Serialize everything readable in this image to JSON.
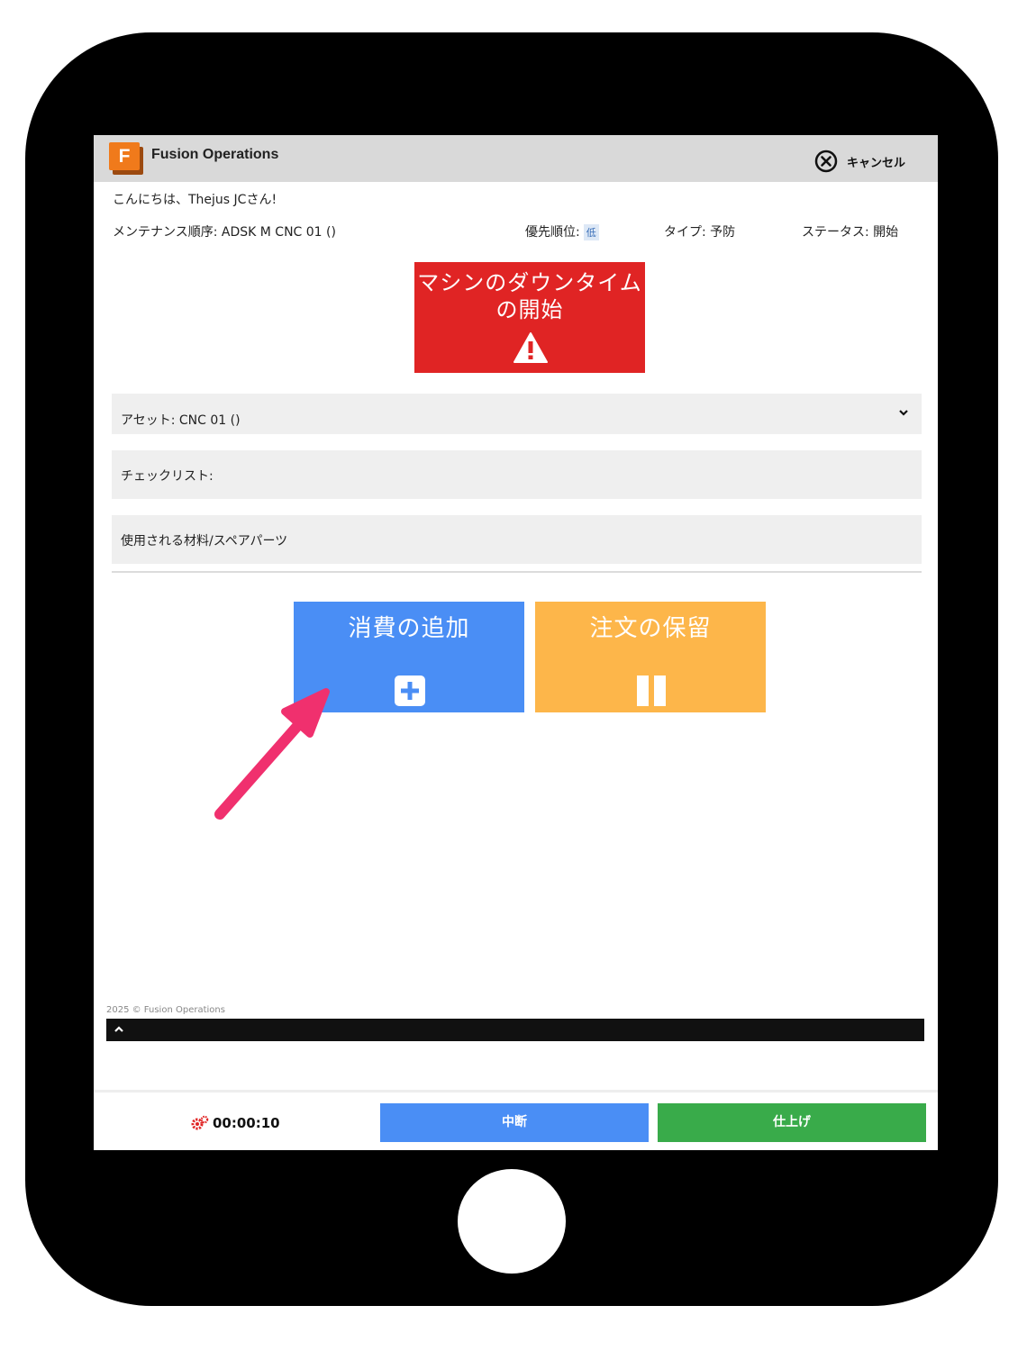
{
  "header": {
    "app_title": "Fusion Operations",
    "logo_letter": "F",
    "cancel_label": "キャンセル",
    "cancel_icon": "close-circle-icon"
  },
  "greeting": "こんにちは、Thejus JCさん!",
  "order_info": {
    "maintenance_order": "メンテナンス順序: ADSK M CNC 01 ()",
    "priority_label": "優先順位:",
    "priority_value": "低",
    "type": "タイプ: 予防",
    "status": "ステータス: 開始"
  },
  "downtime_button": {
    "label": "マシンのダウンタイムの開始",
    "icon": "warning-icon",
    "color": "#e02424"
  },
  "panels": {
    "asset": "アセット: CNC 01 ()",
    "checklist": "チェックリスト:",
    "materials": "使用される材料/スペアパーツ"
  },
  "actions": {
    "add_consumption": {
      "label": "消費の追加",
      "icon": "plus-square-icon",
      "color": "#4a8ef5"
    },
    "hold_order": {
      "label": "注文の保留",
      "icon": "pause-icon",
      "color": "#fdb64a"
    }
  },
  "footer": {
    "copyright": "2025 © Fusion Operations"
  },
  "bottom_bar": {
    "timer": "00:00:10",
    "timer_icon": "gears-icon",
    "interrupt_label": "中断",
    "finish_label": "仕上げ",
    "interrupt_color": "#4a8ef5",
    "finish_color": "#39ab4a"
  },
  "annotation": {
    "arrow_color": "#f0306e"
  }
}
